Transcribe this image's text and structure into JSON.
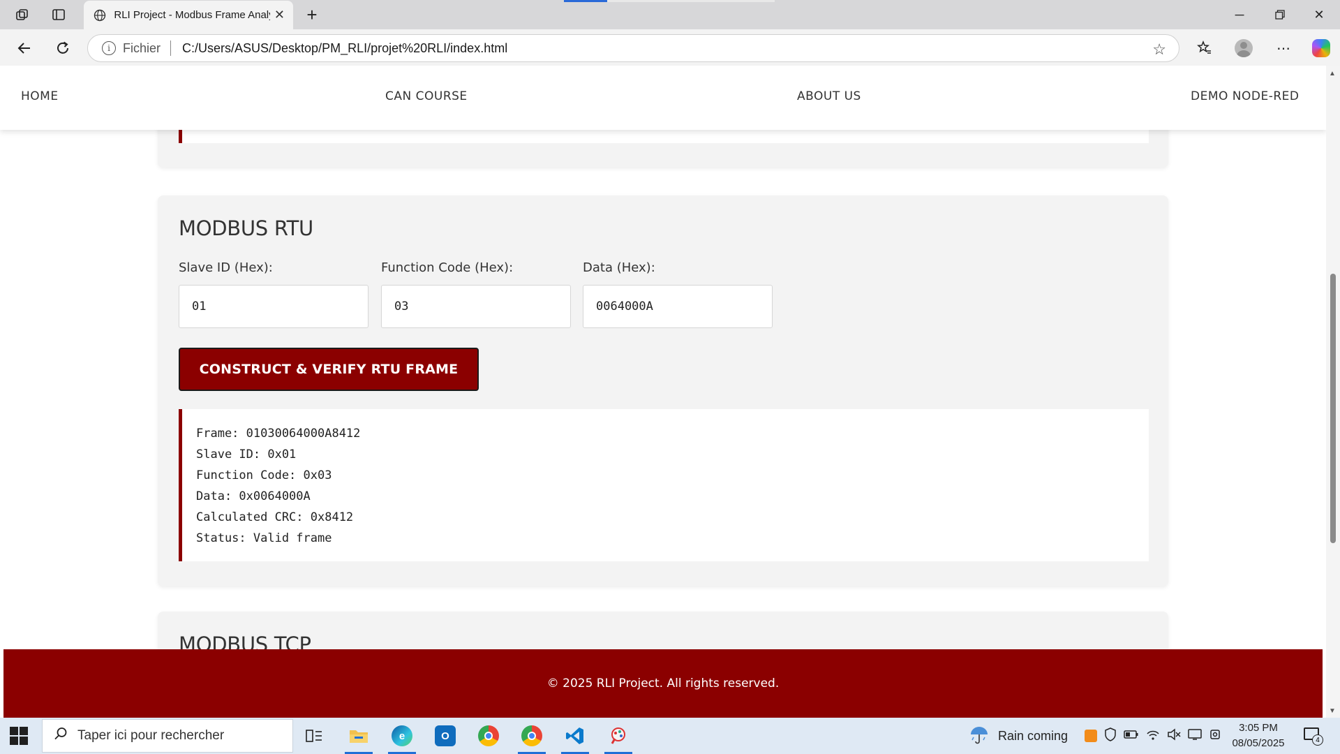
{
  "browser": {
    "tab_title": "RLI Project - Modbus Frame Analyzer",
    "url_scheme": "Fichier",
    "url": "C:/Users/ASUS/Desktop/PM_RLI/projet%20RLI/index.html",
    "icons": [
      "workspaces-icon",
      "tab-actions-icon",
      "globe-icon",
      "close-tab-icon",
      "new-tab-icon",
      "minimize-icon",
      "restore-icon",
      "close-window-icon",
      "back-icon",
      "refresh-icon",
      "info-icon",
      "favorite-star-icon",
      "favorites-icon",
      "profile-icon",
      "more-icon",
      "copilot-icon"
    ]
  },
  "nav": {
    "items": [
      "HOME",
      "CAN COURSE",
      "ABOUT US",
      "DEMO NODE-RED"
    ]
  },
  "rtu": {
    "heading": "MODBUS RTU",
    "fields": [
      {
        "label": "Slave ID (Hex):",
        "value": "01"
      },
      {
        "label": "Function Code (Hex):",
        "value": "03"
      },
      {
        "label": "Data (Hex):",
        "value": "0064000A"
      }
    ],
    "button_label": "CONSTRUCT & VERIFY RTU FRAME",
    "result_lines": [
      "Frame: 01030064000A8412",
      "Slave ID: 0x01",
      "Function Code: 0x03",
      "Data: 0x0064000A",
      "Calculated CRC: 0x8412",
      "Status: Valid frame"
    ]
  },
  "tcp": {
    "heading": "MODBUS TCP"
  },
  "footer": {
    "text": "© 2025 RLI Project. All rights reserved."
  },
  "taskbar": {
    "search_placeholder": "Taper ici pour rechercher",
    "weather": "Rain coming",
    "time": "3:05 PM",
    "date": "08/05/2025",
    "notification_count": "4",
    "apps": [
      "task-view",
      "file-explorer",
      "edge",
      "outlook",
      "chrome",
      "chrome",
      "vscode",
      "paint"
    ]
  },
  "colors": {
    "accent": "#8b0000",
    "card_bg": "#f3f3f3",
    "taskbar_bg": "#dfe9f4"
  }
}
